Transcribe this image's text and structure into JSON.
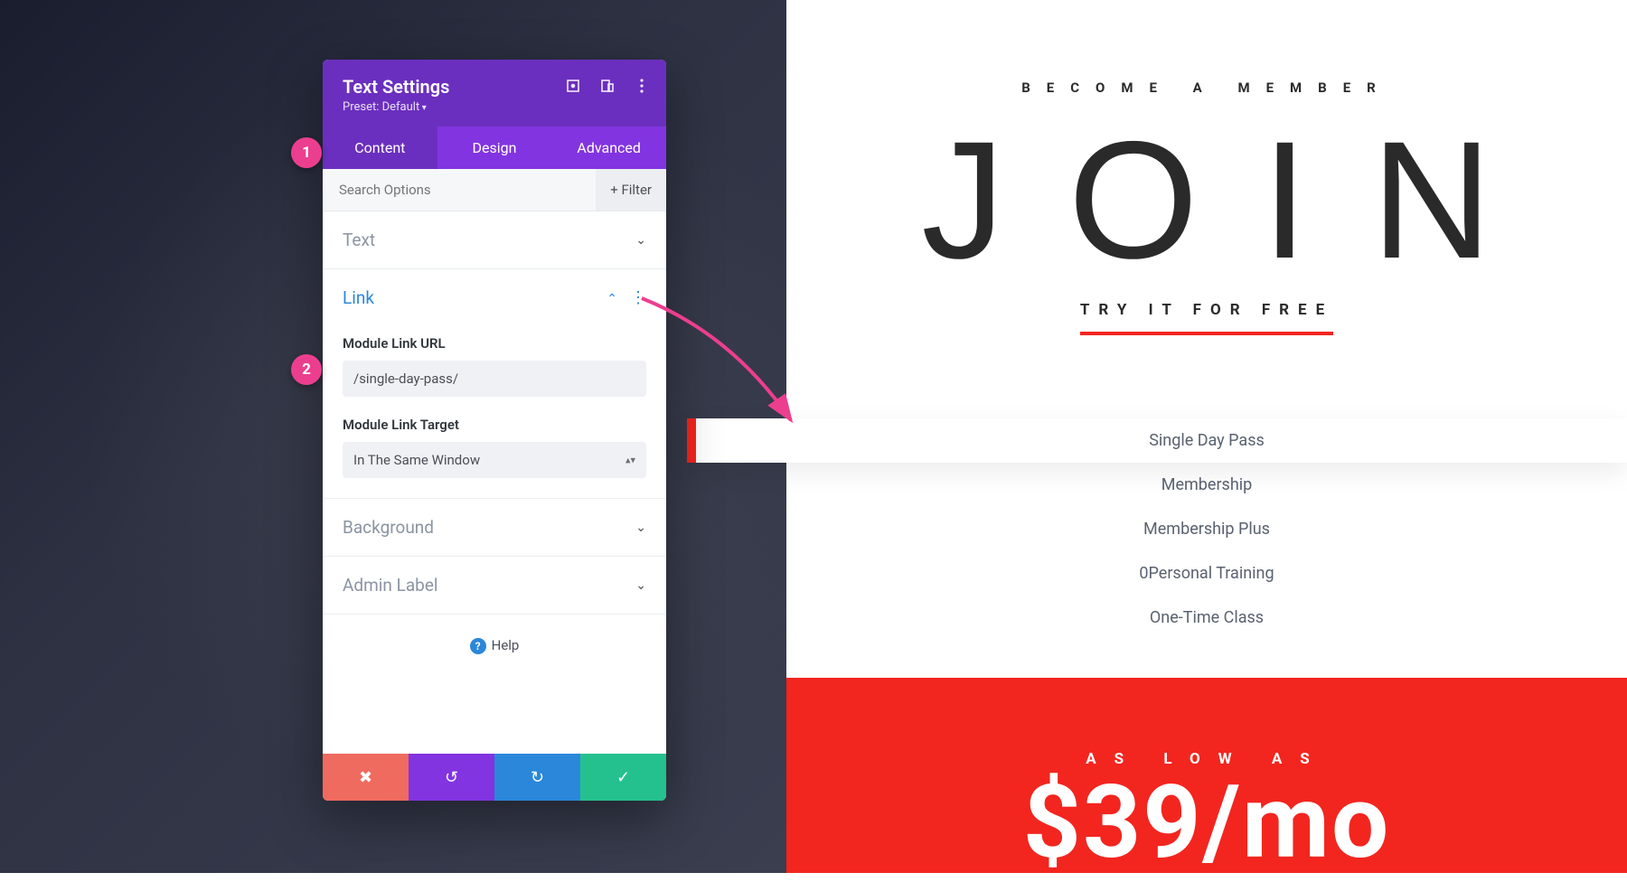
{
  "panel": {
    "title": "Text Settings",
    "preset": "Preset: Default",
    "tabs": {
      "content": "Content",
      "design": "Design",
      "advanced": "Advanced"
    },
    "search_placeholder": "Search Options",
    "filter": "+ Filter",
    "sections": {
      "text": "Text",
      "link": "Link",
      "background": "Background",
      "admin_label": "Admin Label"
    },
    "link": {
      "url_label": "Module Link URL",
      "url_value": "/single-day-pass/",
      "target_label": "Module Link Target",
      "target_value": "In The Same Window"
    },
    "help": "Help"
  },
  "badges": {
    "b1": "1",
    "b2": "2"
  },
  "preview": {
    "kicker": "BECOME A MEMBER",
    "title": "JOIN",
    "cta": "TRY IT FOR FREE",
    "menu": {
      "i0": "Single Day Pass",
      "i1": "Membership",
      "i2": "Membership Plus",
      "i3": "0Personal Training",
      "i4": "One-Time Class"
    },
    "red_kicker": "AS LOW AS",
    "red_price": "$39/mo"
  }
}
